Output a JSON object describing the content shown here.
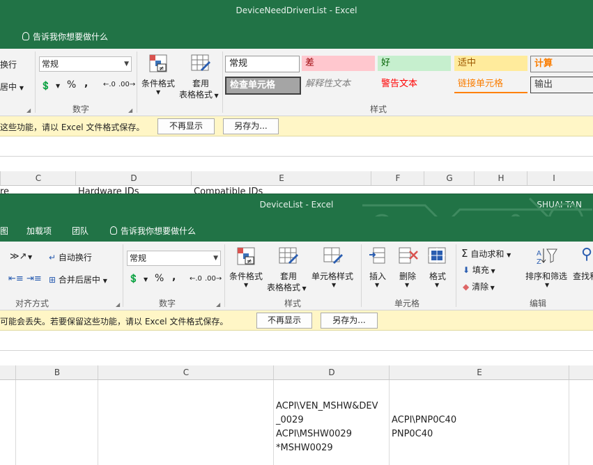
{
  "win1": {
    "title": "DeviceNeedDriverList  -  Excel",
    "tell_me": "告诉我你想要做什么",
    "wrap_partial": "换行",
    "merge_partial": "居中",
    "number_format": "常规",
    "group_number": "数字",
    "cond_format": "条件格式",
    "table_format_1": "套用",
    "table_format_2": "表格格式",
    "group_styles": "样式",
    "styles": {
      "normal": "常规",
      "bad": "差",
      "good": "好",
      "neutral": "适中",
      "calc": "计算",
      "check": "检查单元格",
      "explanatory": "解释性文本",
      "warning": "警告文本",
      "linked": "链接单元格",
      "output": "输出"
    },
    "msg_text": "这些功能，请以 Excel 文件格式保存。",
    "msg_btn_no": "不再显示",
    "msg_btn_saveas": "另存为...",
    "columns": [
      "C",
      "D",
      "E",
      "F",
      "G",
      "H",
      "I"
    ],
    "row_fragments": [
      "re",
      "Hardware IDs",
      "Compatible IDs"
    ]
  },
  "win2": {
    "title": "DeviceList  -  Excel",
    "user": "SHUAI TAN",
    "tab_partial": "图",
    "tab_addins": "加载项",
    "tab_team": "团队",
    "tell_me": "告诉我你想要做什么",
    "wrap_text": "自动换行",
    "merge_center": "合并后居中",
    "group_align": "对齐方式",
    "number_format": "常规",
    "group_number": "数字",
    "cond_format": "条件格式",
    "table_format_1": "套用",
    "table_format_2": "表格格式",
    "cell_styles": "单元格样式",
    "group_styles": "样式",
    "insert": "插入",
    "delete": "删除",
    "format": "格式",
    "group_cells": "单元格",
    "autosum": "自动求和",
    "fill": "填充",
    "clear": "清除",
    "sort_filter": "排序和筛选",
    "find_partial": "查找和",
    "group_edit": "编辑",
    "msg_text": "可能会丢失。若要保留这些功能，请以 Excel 文件格式保存。",
    "msg_btn_no": "不再显示",
    "msg_btn_saveas": "另存为...",
    "columns": [
      "B",
      "C",
      "D",
      "E"
    ],
    "cell_d": [
      "ACPI\\VEN_MSHW&DEV",
      "_0029",
      "ACPI\\MSHW0029",
      "*MSHW0029"
    ],
    "cell_e": [
      "ACPI\\PNP0C40",
      "PNP0C40"
    ]
  },
  "colors": {
    "excel_green": "#217346",
    "message_yellow": "#fff6c6"
  }
}
